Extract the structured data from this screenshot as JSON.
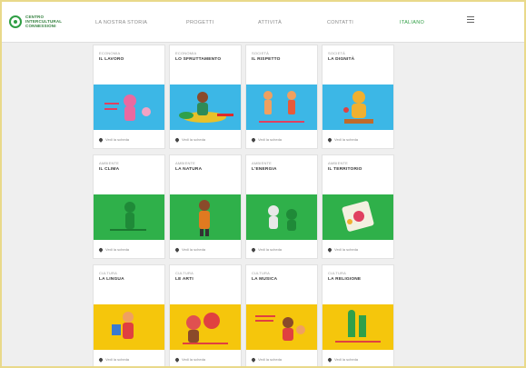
{
  "header": {
    "logo_lines": [
      "CENTRO",
      "INTERCULTURAL",
      "CONNESSIONI"
    ],
    "nav": [
      {
        "label": "LA NOSTRA STORIA",
        "active": false
      },
      {
        "label": "PROGETTI",
        "active": false
      },
      {
        "label": "ATTIVITÀ",
        "active": false
      },
      {
        "label": "CONTATTI",
        "active": false
      },
      {
        "label": "ITALIANO",
        "active": true
      }
    ]
  },
  "cards": [
    {
      "category": "ECONOMIA",
      "title": "IL LAVORO",
      "footer": "Vedi la scheda",
      "color": "blue"
    },
    {
      "category": "ECONOMIA",
      "title": "LO SFRUTTAMENTO",
      "footer": "Vedi la scheda",
      "color": "blue"
    },
    {
      "category": "SOCIETÀ",
      "title": "IL RISPETTO",
      "footer": "Vedi la scheda",
      "color": "blue"
    },
    {
      "category": "SOCIETÀ",
      "title": "LA DIGNITÀ",
      "footer": "Vedi la scheda",
      "color": "blue"
    },
    {
      "category": "AMBIENTE",
      "title": "IL CLIMA",
      "footer": "Vedi la scheda",
      "color": "green"
    },
    {
      "category": "AMBIENTE",
      "title": "LA NATURA",
      "footer": "Vedi la scheda",
      "color": "green"
    },
    {
      "category": "AMBIENTE",
      "title": "L'ENERGIA",
      "footer": "Vedi la scheda",
      "color": "green"
    },
    {
      "category": "AMBIENTE",
      "title": "IL TERRITORIO",
      "footer": "Vedi la scheda",
      "color": "green"
    },
    {
      "category": "CULTURA",
      "title": "LA LINGUA",
      "footer": "Vedi la scheda",
      "color": "yellow"
    },
    {
      "category": "CULTURA",
      "title": "LE ARTI",
      "footer": "Vedi la scheda",
      "color": "yellow"
    },
    {
      "category": "CULTURA",
      "title": "LA MUSICA",
      "footer": "Vedi la scheda",
      "color": "yellow"
    },
    {
      "category": "CULTURA",
      "title": "LA RELIGIONE",
      "footer": "Vedi la scheda",
      "color": "yellow"
    }
  ]
}
